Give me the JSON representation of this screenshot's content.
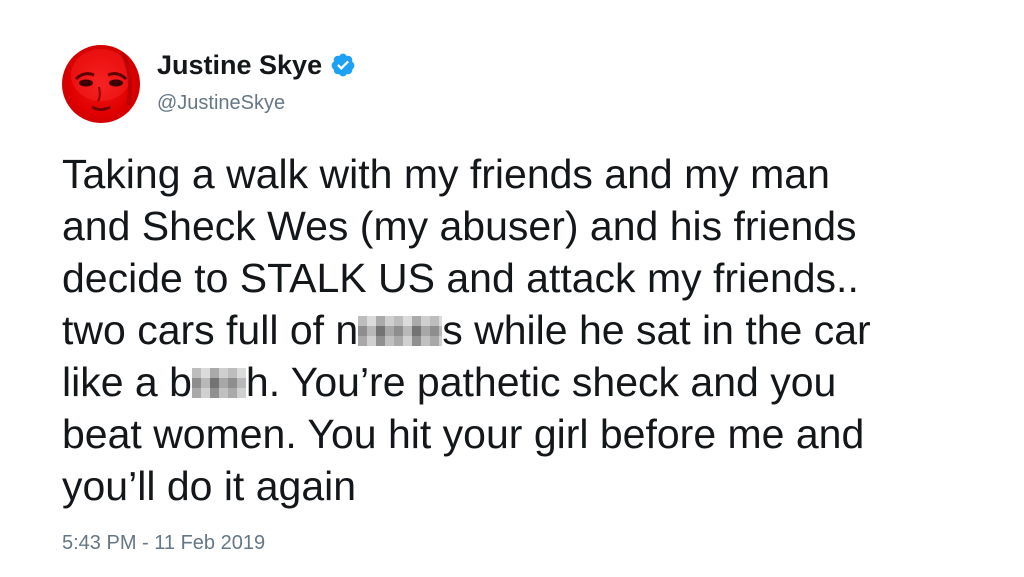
{
  "author": {
    "name": "Justine Skye",
    "handle": "@JustineSkye",
    "avatar_icon": "profile-photo",
    "verified_icon": "verified-badge-icon"
  },
  "tweet": {
    "line1": "Taking a walk with my friends and my man",
    "line2": "and Sheck Wes (my abuser) and his friends",
    "line3": "decide to STALK US and attack my friends..",
    "line4_before": "two cars full of n",
    "line4_after": "s while he sat in the car",
    "line5_before": "like a b",
    "line5_after": "h. You’re pathetic sheck and you",
    "line6": "beat women. You hit your girl before me and",
    "line7": "you’ll do it again",
    "timestamp": "5:43 PM - 11 Feb 2019"
  },
  "colors": {
    "text": "#14171a",
    "secondary_text": "#657786",
    "verified_blue": "#1da1f2",
    "avatar_red": "#e00000"
  }
}
